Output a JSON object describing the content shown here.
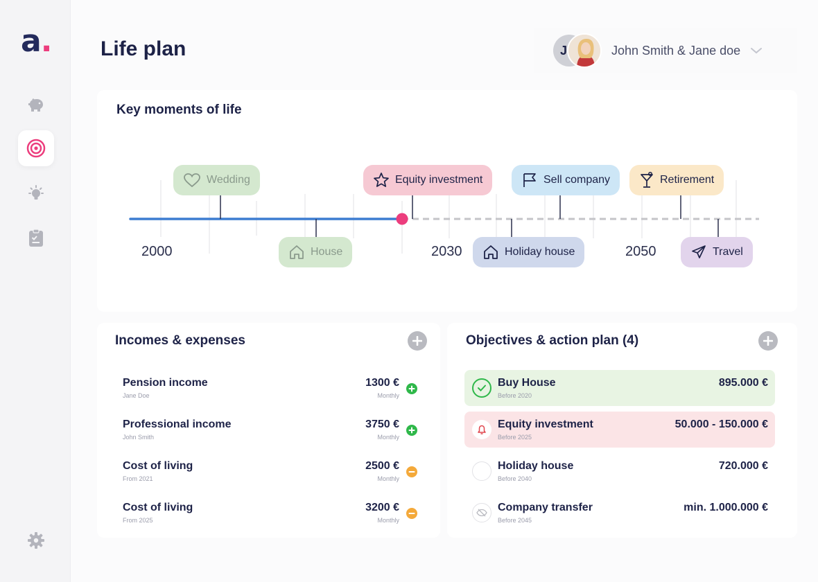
{
  "app": {
    "logo_text": "a",
    "logo_dot": "."
  },
  "sidebar": {
    "items": [
      {
        "icon": "piggy-bank-icon",
        "active": false
      },
      {
        "icon": "target-icon",
        "active": true
      },
      {
        "icon": "lightbulb-icon",
        "active": false
      },
      {
        "icon": "document-icon",
        "active": false
      }
    ],
    "settings_icon": "gear-icon"
  },
  "header": {
    "title": "Life plan",
    "avatar_initial": "J",
    "user_name": "John Smith & Jane doe"
  },
  "key_moments": {
    "title": "Key moments of life",
    "years": [
      "2000",
      "2030",
      "2050"
    ],
    "events": [
      {
        "label": "Wedding",
        "icon": "heart-icon",
        "color": "#d4e8cf",
        "past": true
      },
      {
        "label": "House",
        "icon": "home-icon",
        "color": "#d4e8cf",
        "past": true
      },
      {
        "label": "Equity investment",
        "icon": "star-icon",
        "color": "#f6c9d3",
        "past": false
      },
      {
        "label": "Sell company",
        "icon": "flag-icon",
        "color": "#cde6f6",
        "past": false
      },
      {
        "label": "Holiday house",
        "icon": "home-icon",
        "color": "#cfd8ec",
        "past": false
      },
      {
        "label": "Retirement",
        "icon": "cocktail-icon",
        "color": "#fbe8c8",
        "past": false
      },
      {
        "label": "Travel",
        "icon": "plane-icon",
        "color": "#e2d4ec",
        "past": false
      }
    ],
    "colors": {
      "past_line": "#3d7dd1",
      "today_marker": "#ec3d7d",
      "future_line": "#c4c4c8"
    }
  },
  "incomes": {
    "title": "Incomes & expenses",
    "rows": [
      {
        "title": "Pension income",
        "sub": "Jane Doe",
        "amount": "1300 €",
        "period": "Monthly",
        "type": "income"
      },
      {
        "title": "Professional income",
        "sub": "John Smith",
        "amount": "3750 €",
        "period": "Monthly",
        "type": "income"
      },
      {
        "title": "Cost of living",
        "sub": "From 2021",
        "amount": "2500 €",
        "period": "Monthly",
        "type": "expense"
      },
      {
        "title": "Cost of living",
        "sub": "From 2025",
        "amount": "3200 €",
        "period": "Monthly",
        "type": "expense"
      }
    ],
    "colors": {
      "income": "#2fb84a",
      "expense": "#f4a93a"
    }
  },
  "objectives": {
    "title": "Objectives & action plan (4)",
    "rows": [
      {
        "title": "Buy House",
        "sub": "Before 2020",
        "amount": "895.000 €",
        "status": "done",
        "bg": "#e8f4e3"
      },
      {
        "title": "Equity investment",
        "sub": "Before 2025",
        "amount": "50.000 - 150.000 €",
        "status": "alert",
        "bg": "#fbe4e6"
      },
      {
        "title": "Holiday house",
        "sub": "Before 2040",
        "amount": "720.000 €",
        "status": "pending",
        "bg": "#ffffff"
      },
      {
        "title": "Company transfer",
        "sub": "Before 2045",
        "amount": "min. 1.000.000 €",
        "status": "hidden",
        "bg": "#ffffff"
      }
    ]
  }
}
